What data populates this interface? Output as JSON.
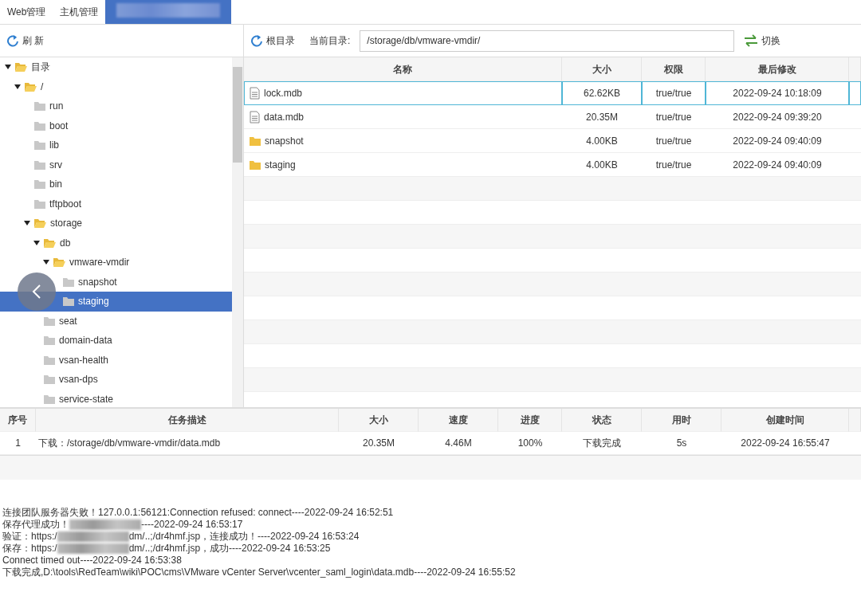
{
  "tabs": [
    {
      "label": "Web管理",
      "selected": false
    },
    {
      "label": "主机管理",
      "selected": false
    },
    {
      "redacted": true,
      "selected": true
    }
  ],
  "left_toolbar": {
    "refresh": "刷 新"
  },
  "tree": [
    {
      "label": "目录",
      "expanded": true,
      "selected": false,
      "children": [
        {
          "label": "/",
          "expanded": true,
          "selected": false,
          "children": [
            {
              "label": "run",
              "expanded": false,
              "selected": false
            },
            {
              "label": "boot",
              "expanded": false,
              "selected": false
            },
            {
              "label": "lib",
              "expanded": false,
              "selected": false
            },
            {
              "label": "srv",
              "expanded": false,
              "selected": false
            },
            {
              "label": "bin",
              "expanded": false,
              "selected": false
            },
            {
              "label": "tftpboot",
              "expanded": false,
              "selected": false
            },
            {
              "label": "storage",
              "expanded": true,
              "selected": false,
              "children": [
                {
                  "label": "db",
                  "expanded": true,
                  "selected": false,
                  "children": [
                    {
                      "label": "vmware-vmdir",
                      "expanded": true,
                      "selected": false,
                      "children": [
                        {
                          "label": "snapshot",
                          "expanded": false,
                          "selected": false
                        },
                        {
                          "label": "staging",
                          "expanded": false,
                          "selected": true
                        }
                      ]
                    }
                  ]
                },
                {
                  "label": "seat",
                  "expanded": false,
                  "selected": false
                },
                {
                  "label": "domain-data",
                  "expanded": false,
                  "selected": false
                },
                {
                  "label": "vsan-health",
                  "expanded": false,
                  "selected": false
                },
                {
                  "label": "vsan-dps",
                  "expanded": false,
                  "selected": false
                },
                {
                  "label": "service-state",
                  "expanded": false,
                  "selected": false
                }
              ]
            }
          ]
        }
      ]
    }
  ],
  "right_toolbar": {
    "root": "根目录",
    "path_label": "当前目录:",
    "path": "/storage/db/vmware-vmdir/",
    "switch": "切换"
  },
  "files": {
    "columns": [
      "名称",
      "大小",
      "权限",
      "最后修改"
    ],
    "rows": [
      {
        "kind": "file",
        "name": "lock.mdb",
        "size": "62.62KB",
        "perm": "true/true",
        "modified": "2022-09-24 10:18:09",
        "selected": true
      },
      {
        "kind": "file",
        "name": "data.mdb",
        "size": "20.35M",
        "perm": "true/true",
        "modified": "2022-09-24 09:39:20",
        "selected": false
      },
      {
        "kind": "folder",
        "name": "snapshot",
        "size": "4.00KB",
        "perm": "true/true",
        "modified": "2022-09-24 09:40:09",
        "selected": false
      },
      {
        "kind": "folder",
        "name": "staging",
        "size": "4.00KB",
        "perm": "true/true",
        "modified": "2022-09-24 09:40:09",
        "selected": false
      }
    ]
  },
  "tasks": {
    "columns": [
      "序号",
      "任务描述",
      "大小",
      "速度",
      "进度",
      "状态",
      "用时",
      "创建时间"
    ],
    "rows": [
      [
        "1",
        "下载：/storage/db/vmware-vmdir/data.mdb",
        "20.35M",
        "4.46M",
        "100%",
        "下载完成",
        "5s",
        "2022-09-24 16:55:47"
      ]
    ]
  },
  "log": [
    {
      "parts": [
        "连接团队服务器失败！127.0.0.1:56121:Connection refused: connect----2022-09-24 16:52:51"
      ]
    },
    {
      "parts": [
        "保存代理成功！",
        "----2022-09-24 16:53:17"
      ]
    },
    {
      "parts": [
        "验证：https:/",
        "dm/..;/dr4hmf.jsp，连接成功！----2022-09-24 16:53:24"
      ]
    },
    {
      "parts": [
        "保存：https:/",
        "dm/..;/dr4hmf.jsp，成功----2022-09-24 16:53:25"
      ]
    },
    {
      "parts": [
        "Connect timed out----2022-09-24 16:53:38"
      ]
    },
    {
      "parts": [
        "下载完成,D:\\tools\\RedTeam\\wiki\\POC\\cms\\VMware vCenter Server\\vcenter_saml_login\\data.mdb----2022-09-24 16:55:52"
      ]
    }
  ]
}
